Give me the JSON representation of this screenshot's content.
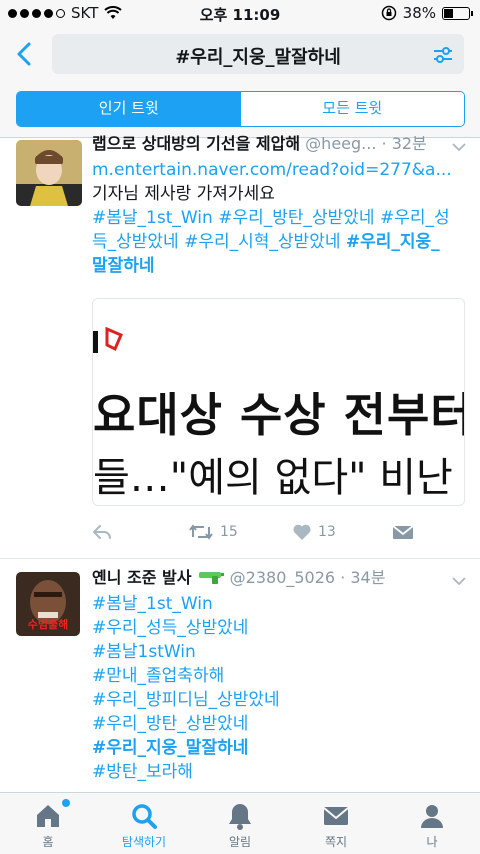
{
  "status": {
    "carrier": "SKT",
    "time": "오후 11:09",
    "battery": "38%",
    "battery_level": 0.38,
    "signal_bars": 4
  },
  "search": {
    "query": "#우리_지웅_말잘하네"
  },
  "tabs": {
    "top": "인기 트윗",
    "all": "모든 트윗"
  },
  "tweets": [
    {
      "name": "랩으로 상대방의 기선을 제압해",
      "handle": "@heeg...",
      "time": "· 32분",
      "link": "m.entertain.naver.com/read?oid=277&a...",
      "text": "기자님 제사랑 가져가세요",
      "hashtag_line1": "#봄날_1st_Win #우리_방탄_상받았네 #우리_성",
      "hashtag_line2": "득_상받았네 #우리_시혁_상받았네 ",
      "hashtag_line2_bold": "#우리_지웅_",
      "hashtag_line3_bold": "말잘하네",
      "media_line1": "요대상 수상 전부터",
      "media_line2": "들…\"예의 없다\" 비난",
      "retweets": "15",
      "likes": "13"
    },
    {
      "name": "옌니 조준 발사",
      "handle": "@2380_5026",
      "time": "· 34분",
      "avatar_text": "수범출해",
      "hashtags": [
        "#봄날_1st_Win",
        "#우리_성득_상받았네",
        "#봄날1stWin",
        "#맏내_졸업축하해",
        "#우리_방피디님_상받았네",
        "#우리_방탄_상받았네",
        "#우리_지웅_말잘하네",
        "#방탄_보라해"
      ]
    }
  ],
  "tabbar": {
    "home": "홈",
    "search": "탐색하기",
    "notifications": "알림",
    "messages": "쪽지",
    "me": "나"
  },
  "colors": {
    "accent": "#1da1f2",
    "muted": "#8899a6"
  }
}
